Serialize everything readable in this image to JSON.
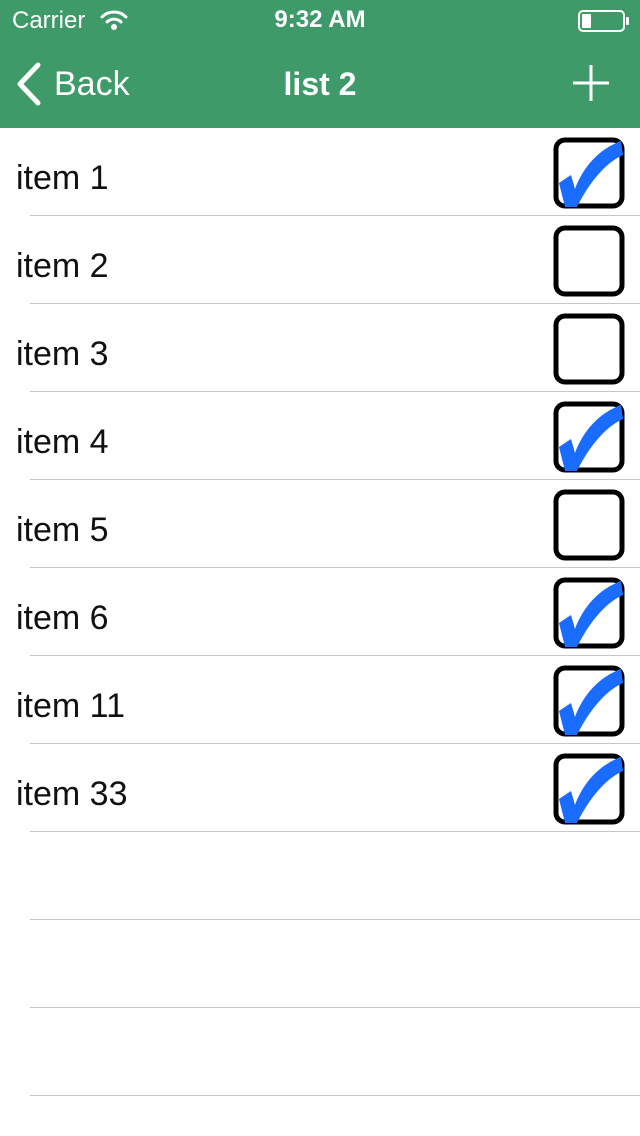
{
  "status_bar": {
    "carrier": "Carrier",
    "time": "9:32 AM"
  },
  "nav": {
    "back_label": "Back",
    "title": "list 2",
    "add_icon": "plus-icon"
  },
  "colors": {
    "header": "#3f9a69",
    "check": "#1a6cff",
    "separator": "#c8c7cc"
  },
  "items": [
    {
      "label": "item 1",
      "checked": true
    },
    {
      "label": "item 2",
      "checked": false
    },
    {
      "label": "item 3",
      "checked": false
    },
    {
      "label": "item 4",
      "checked": true
    },
    {
      "label": "item 5",
      "checked": false
    },
    {
      "label": "item 6",
      "checked": true
    },
    {
      "label": "item 11",
      "checked": true
    },
    {
      "label": "item 33",
      "checked": true
    }
  ],
  "empty_rows": 3
}
